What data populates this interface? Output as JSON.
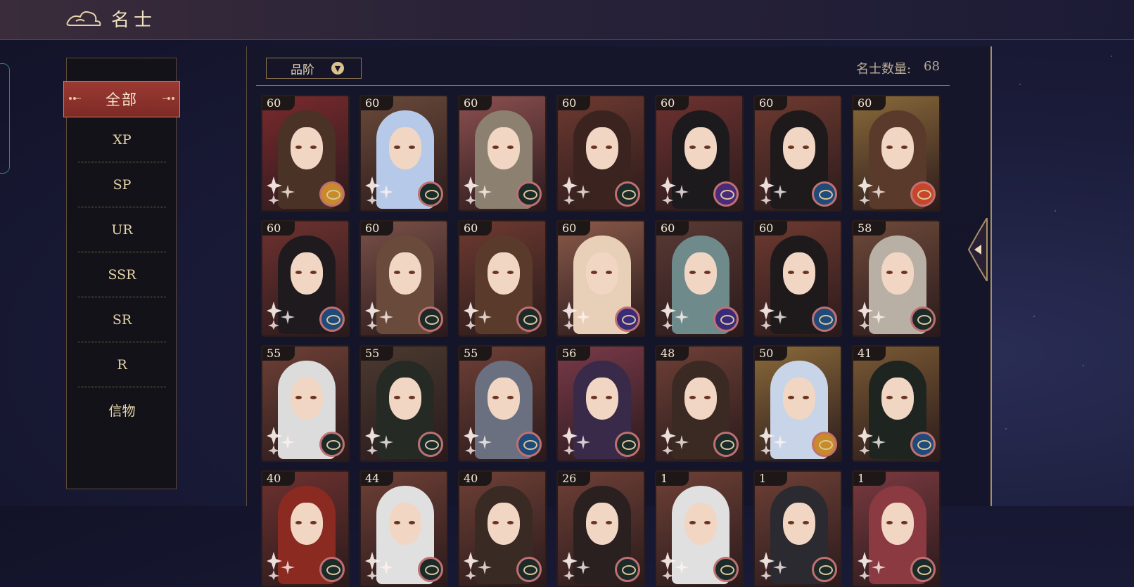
{
  "header": {
    "title": "名士"
  },
  "filters": {
    "active": "全部",
    "items": [
      "XP",
      "SP",
      "UR",
      "SSR",
      "SR",
      "R",
      "信物"
    ]
  },
  "toolbar": {
    "sort_label": "品阶",
    "count_label": "名士数量:",
    "count_value": "68"
  },
  "colors": {
    "accent_red": "#9b3a32",
    "gold": "#d9c28e",
    "panel_bg": "#14142a"
  },
  "cards": [
    {
      "level": "60",
      "bg": "#7a2a2e",
      "hair": "#4b3226",
      "badge": "#c98a2a",
      "badge_icon": "sun-emblem-icon"
    },
    {
      "level": "60",
      "bg": "#6a4a3a",
      "hair": "#b7c9e8",
      "badge": "#1c2a2a",
      "badge_icon": "compass-emblem-icon"
    },
    {
      "level": "60",
      "bg": "#8c5050",
      "hair": "#8c8070",
      "badge": "#1c2a2a",
      "badge_icon": "compass-emblem-icon"
    },
    {
      "level": "60",
      "bg": "#6e3a30",
      "hair": "#3b2420",
      "badge": "#1c2a2a",
      "badge_icon": "compass-emblem-icon"
    },
    {
      "level": "60",
      "bg": "#6e3230",
      "hair": "#1d1a1e",
      "badge": "#4a2a7a",
      "badge_icon": "orb-emblem-icon"
    },
    {
      "level": "60",
      "bg": "#6e3a30",
      "hair": "#1e1a1c",
      "badge": "#1f4a7a",
      "badge_icon": "wave-emblem-icon"
    },
    {
      "level": "60",
      "bg": "#8a6a3a",
      "hair": "#5a3a2a",
      "badge": "#c9452a",
      "badge_icon": "sun-emblem-icon"
    },
    {
      "level": "60",
      "bg": "#6e3230",
      "hair": "#1e1a1e",
      "badge": "#1f4a7a",
      "badge_icon": "wave-emblem-icon"
    },
    {
      "level": "60",
      "bg": "#7a5048",
      "hair": "#6a4a3a",
      "badge": "#1c2a2a",
      "badge_icon": "compass-emblem-icon"
    },
    {
      "level": "60",
      "bg": "#6e3a30",
      "hair": "#5a3a2a",
      "badge": "#1c2a2a",
      "badge_icon": "compass-emblem-icon"
    },
    {
      "level": "60",
      "bg": "#8a5a4a",
      "hair": "#e8cfb8",
      "badge": "#3a2a7a",
      "badge_icon": "orb-emblem-icon"
    },
    {
      "level": "60",
      "bg": "#5a3a34",
      "hair": "#6f8a8a",
      "badge": "#3a2a7a",
      "badge_icon": "orb-emblem-icon"
    },
    {
      "level": "60",
      "bg": "#6e3a30",
      "hair": "#1e1a1c",
      "badge": "#1f4a7a",
      "badge_icon": "wave-emblem-icon"
    },
    {
      "level": "58",
      "bg": "#6e4a3a",
      "hair": "#b8b0a4",
      "badge": "#1c2a2a",
      "badge_icon": "compass-emblem-icon"
    },
    {
      "level": "55",
      "bg": "#6e4036",
      "hair": "#dcdcdc",
      "badge": "#1c2a2a",
      "badge_icon": "compass-emblem-icon"
    },
    {
      "level": "55",
      "bg": "#4a3a30",
      "hair": "#262a24",
      "badge": "#1c2a2a",
      "badge_icon": "compass-emblem-icon"
    },
    {
      "level": "55",
      "bg": "#6e4036",
      "hair": "#6a7080",
      "badge": "#1f4a7a",
      "badge_icon": "wave-emblem-icon"
    },
    {
      "level": "56",
      "bg": "#7a3a4a",
      "hair": "#3a2a4a",
      "badge": "#1c2a2a",
      "badge_icon": "compass-emblem-icon"
    },
    {
      "level": "48",
      "bg": "#6e4036",
      "hair": "#3b2a24",
      "badge": "#1c2a2a",
      "badge_icon": "compass-emblem-icon"
    },
    {
      "level": "50",
      "bg": "#8a6a3a",
      "hair": "#c8d4e8",
      "badge": "#c98a2a",
      "badge_icon": "sun-emblem-icon"
    },
    {
      "level": "41",
      "bg": "#7a5a34",
      "hair": "#1e2420",
      "badge": "#1f4a7a",
      "badge_icon": "wave-emblem-icon"
    },
    {
      "level": "40",
      "bg": "#6e3230",
      "hair": "#8a2a20",
      "badge": "#1c2a2a",
      "badge_icon": "compass-emblem-icon"
    },
    {
      "level": "44",
      "bg": "#6e4036",
      "hair": "#e0e0e0",
      "badge": "#1c2a2a",
      "badge_icon": "compass-emblem-icon"
    },
    {
      "level": "40",
      "bg": "#6e4036",
      "hair": "#3a2a24",
      "badge": "#1c2a2a",
      "badge_icon": "compass-emblem-icon"
    },
    {
      "level": "26",
      "bg": "#6e4036",
      "hair": "#2a2020",
      "badge": "#1c2a2a",
      "badge_icon": "compass-emblem-icon"
    },
    {
      "level": "1",
      "bg": "#6e4036",
      "hair": "#e0e0e0",
      "badge": "#1c2a2a",
      "badge_icon": "compass-emblem-icon"
    },
    {
      "level": "1",
      "bg": "#6e4036",
      "hair": "#2a2a30",
      "badge": "#1c2a2a",
      "badge_icon": "compass-emblem-icon"
    },
    {
      "level": "1",
      "bg": "#7a3a40",
      "hair": "#8a3a40",
      "badge": "#1c2a2a",
      "badge_icon": "compass-emblem-icon"
    }
  ]
}
